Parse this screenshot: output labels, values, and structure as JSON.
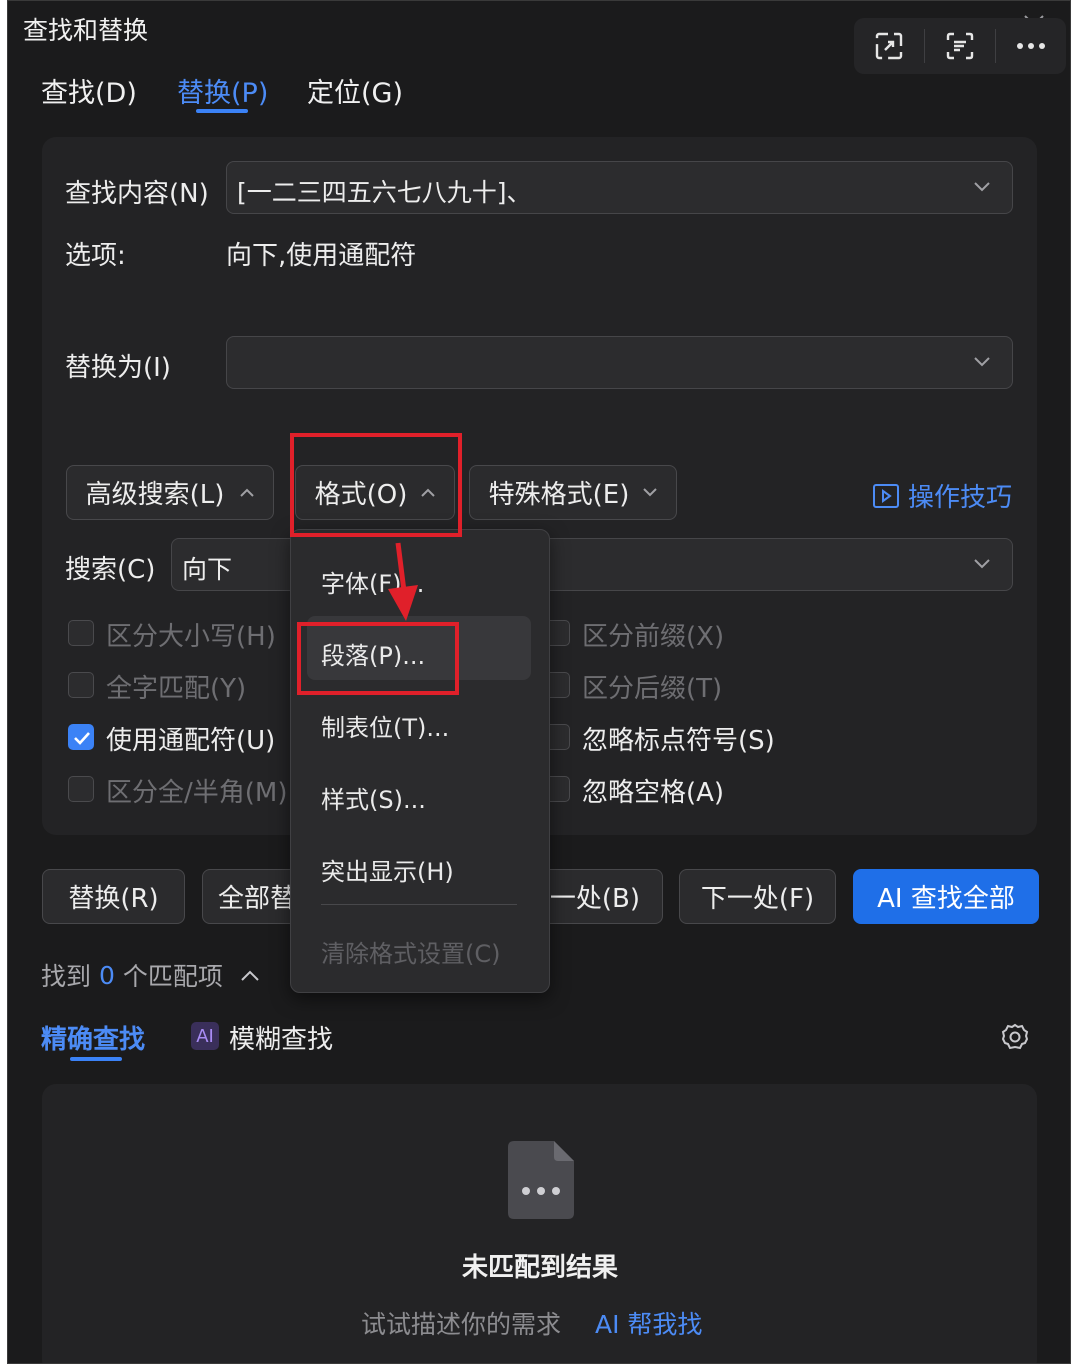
{
  "window": {
    "title": "查找和替换"
  },
  "toolbar": {
    "expand_icon": "expand-icon",
    "scan_icon": "scan-icon",
    "more_icon": "more-icon"
  },
  "tabs": [
    {
      "label": "查找(D)",
      "active": false
    },
    {
      "label": "替换(P)",
      "active": true
    },
    {
      "label": "定位(G)",
      "active": false
    }
  ],
  "find": {
    "label": "查找内容(N)",
    "value": "[一二三四五六七八九十]、"
  },
  "options": {
    "label": "选项:",
    "value": "向下,使用通配符"
  },
  "replace": {
    "label": "替换为(I)",
    "value": ""
  },
  "buttons": {
    "advanced": "高级搜索(L)",
    "format": "格式(O)",
    "special": "特殊格式(E)",
    "tips": "操作技巧"
  },
  "search": {
    "label": "搜索(C)",
    "value": "向下"
  },
  "checkboxes_left": [
    {
      "label": "区分大小写(H)",
      "checked": false,
      "enabled": false
    },
    {
      "label": "全字匹配(Y)",
      "checked": false,
      "enabled": false
    },
    {
      "label": "使用通配符(U)",
      "checked": true,
      "enabled": true
    },
    {
      "label": "区分全/半角(M)",
      "checked": false,
      "enabled": false
    }
  ],
  "checkboxes_right": [
    {
      "label": "区分前缀(X)",
      "checked": false,
      "enabled": false
    },
    {
      "label": "区分后缀(T)",
      "checked": false,
      "enabled": false
    },
    {
      "label": "忽略标点符号(S)",
      "checked": false,
      "enabled": true
    },
    {
      "label": "忽略空格(A)",
      "checked": false,
      "enabled": true
    }
  ],
  "format_menu": {
    "items": [
      "字体(F)...",
      "段落(P)...",
      "制表位(T)...",
      "样式(S)...",
      "突出显示(H)",
      "清除格式设置(C)"
    ],
    "highlighted": "段落(P)..."
  },
  "actions": {
    "replace": "替换(R)",
    "replace_all": "全部替",
    "prev": "一处(B)",
    "next": "下一处(F)",
    "ai_find_all": "AI 查找全部"
  },
  "results": {
    "found_prefix": "找到",
    "count": "0",
    "found_suffix": "个匹配项",
    "tab_exact": "精确查找",
    "ai_badge": "AI",
    "tab_fuzzy": "模糊查找",
    "empty_title": "未匹配到结果",
    "hint": "试试描述你的需求",
    "ai_help": "AI 帮我找"
  },
  "colors": {
    "accent": "#3b82f6",
    "annotation": "#e0202a",
    "background": "#1b1b1c"
  }
}
